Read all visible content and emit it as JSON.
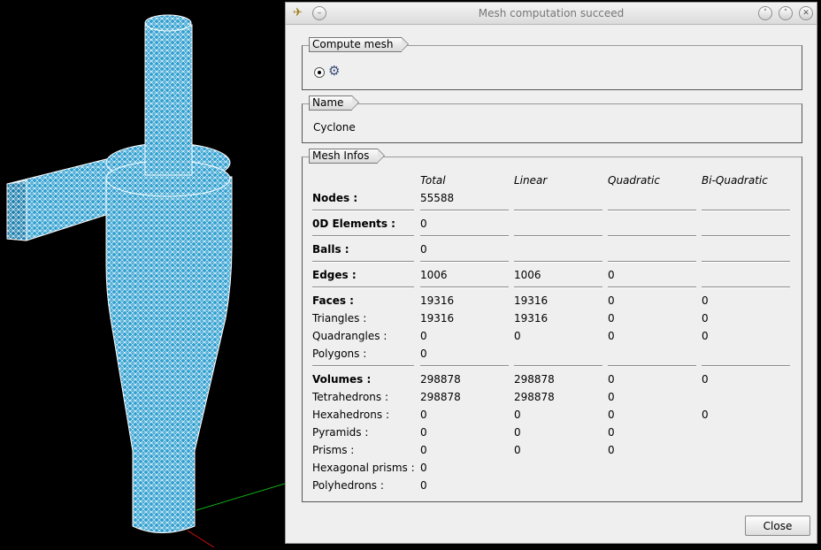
{
  "dialog": {
    "title": "Mesh computation succeed",
    "compute_mesh_label": "Compute mesh",
    "name_label": "Name",
    "mesh_name": "Cyclone",
    "mesh_infos_label": "Mesh Infos",
    "close_label": "Close"
  },
  "columns": [
    "Total",
    "Linear",
    "Quadratic",
    "Bi-Quadratic"
  ],
  "rows": [
    {
      "label": "Nodes :",
      "bold": true,
      "values": [
        "55588",
        "",
        "",
        ""
      ],
      "sep": true
    },
    {
      "label": "0D Elements :",
      "bold": true,
      "values": [
        "0",
        "",
        "",
        ""
      ],
      "sep": true
    },
    {
      "label": "Balls :",
      "bold": true,
      "values": [
        "0",
        "",
        "",
        ""
      ],
      "sep": true
    },
    {
      "label": "Edges :",
      "bold": true,
      "values": [
        "1006",
        "1006",
        "0",
        ""
      ],
      "sep": true
    },
    {
      "label": "Faces :",
      "bold": true,
      "values": [
        "19316",
        "19316",
        "0",
        "0"
      ],
      "sep": false
    },
    {
      "label": "Triangles :",
      "bold": false,
      "values": [
        "19316",
        "19316",
        "0",
        "0"
      ],
      "sep": false
    },
    {
      "label": "Quadrangles :",
      "bold": false,
      "values": [
        "0",
        "0",
        "0",
        "0"
      ],
      "sep": false
    },
    {
      "label": "Polygons :",
      "bold": false,
      "values": [
        "0",
        "",
        "",
        ""
      ],
      "sep": true
    },
    {
      "label": "Volumes :",
      "bold": true,
      "values": [
        "298878",
        "298878",
        "0",
        "0"
      ],
      "sep": false
    },
    {
      "label": "Tetrahedrons :",
      "bold": false,
      "values": [
        "298878",
        "298878",
        "0",
        ""
      ],
      "sep": false
    },
    {
      "label": "Hexahedrons :",
      "bold": false,
      "values": [
        "0",
        "0",
        "0",
        "0"
      ],
      "sep": false
    },
    {
      "label": "Pyramids :",
      "bold": false,
      "values": [
        "0",
        "0",
        "0",
        ""
      ],
      "sep": false
    },
    {
      "label": "Prisms :",
      "bold": false,
      "values": [
        "0",
        "0",
        "0",
        ""
      ],
      "sep": false
    },
    {
      "label": "Hexagonal prisms :",
      "bold": false,
      "values": [
        "0",
        "",
        "",
        ""
      ],
      "sep": false
    },
    {
      "label": "Polyhedrons :",
      "bold": false,
      "values": [
        "0",
        "",
        "",
        ""
      ],
      "sep": false
    }
  ],
  "colors": {
    "mesh": "#2f9fd0",
    "mesh_line": "#ffffff",
    "axis_x": "#d01010",
    "axis_y": "#10b010"
  }
}
